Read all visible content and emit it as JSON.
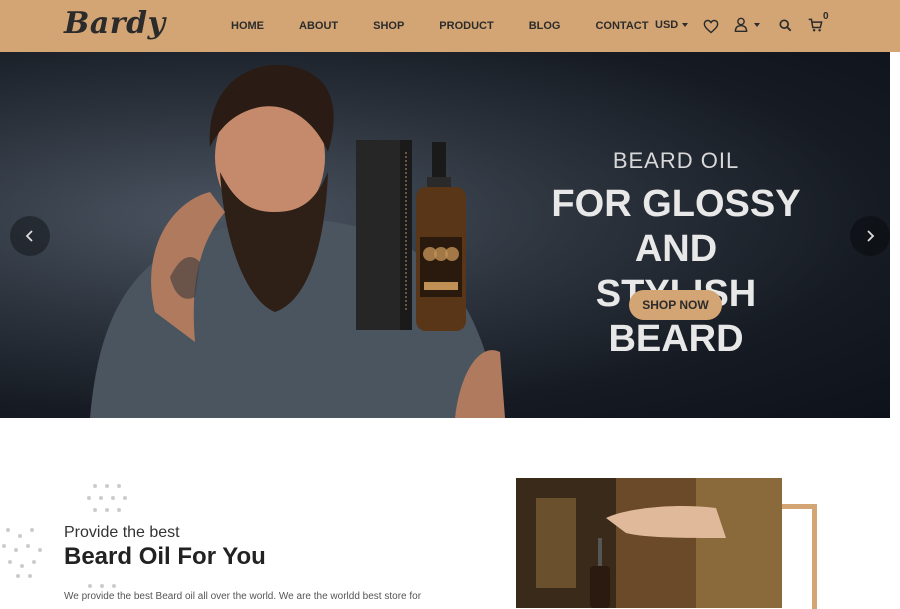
{
  "header": {
    "logo": "Bardy",
    "nav": [
      "HOME",
      "ABOUT",
      "SHOP",
      "PRODUCT",
      "BLOG",
      "CONTACT"
    ],
    "currency": "USD",
    "cart_count": "0",
    "icons": [
      "heart-icon",
      "user-icon",
      "search-icon",
      "cart-icon"
    ]
  },
  "hero": {
    "subtitle": "BEARD OIL",
    "title_line1": "FOR GLOSSY AND",
    "title_line2": "STYLISH BEARD",
    "button": "SHOP NOW",
    "prev_icon": "chevron-left-icon",
    "next_icon": "chevron-right-icon"
  },
  "intro": {
    "subtitle": "Provide the best",
    "title": "Beard Oil For You",
    "text": "We provide the best Beard oil all over the world. We are the worldd best store for"
  },
  "colors": {
    "accent": "#d4a574",
    "dark": "#2b2b2b"
  }
}
